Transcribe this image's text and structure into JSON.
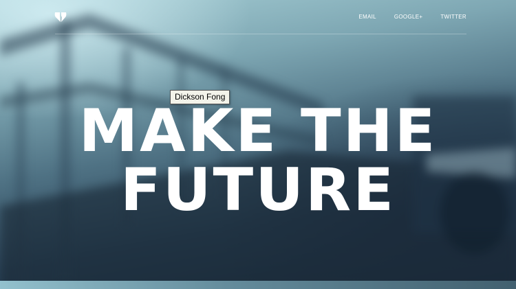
{
  "nav": {
    "links": [
      "EMAIL",
      "GOOGLE+",
      "TWITTER"
    ]
  },
  "logo": {
    "icon": "heart-split-icon"
  },
  "tooltip": {
    "text": "Dickson Fong"
  },
  "headline": {
    "line1": "MAKE THE",
    "line2": "FUTURE"
  },
  "colors": {
    "text": "#ffffff",
    "background_dark": "#172634",
    "background_light": "#a7cfd6"
  }
}
